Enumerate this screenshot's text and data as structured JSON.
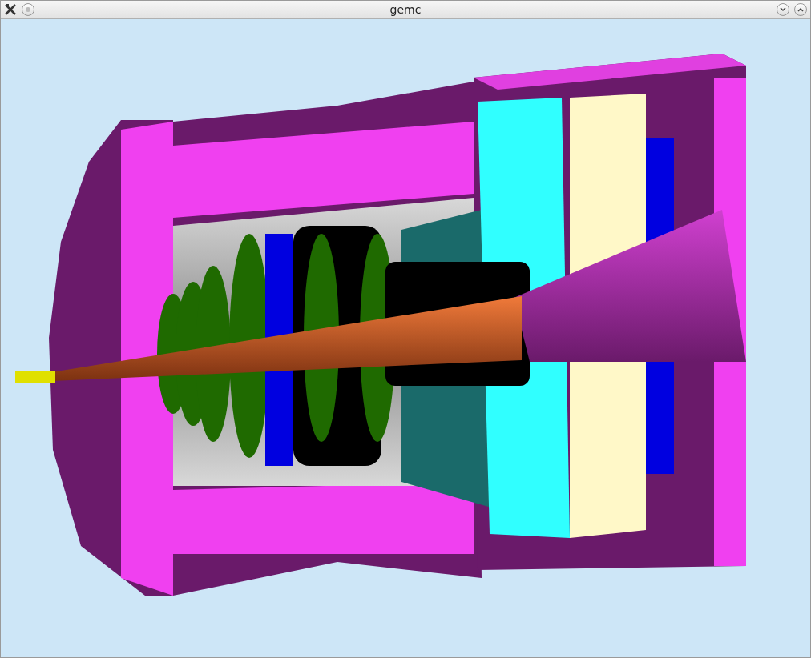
{
  "window": {
    "title": "gemc"
  }
}
